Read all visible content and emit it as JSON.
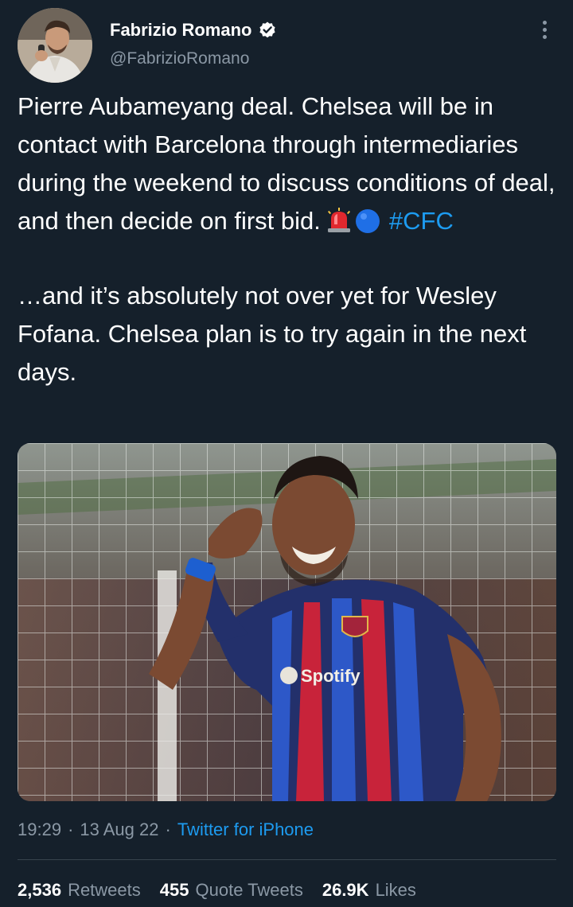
{
  "author": {
    "display_name": "Fabrizio Romano",
    "handle": "@FabrizioRomano",
    "verified_icon": "verified-badge-icon"
  },
  "tweet": {
    "paragraph1": "Pierre Aubameyang deal. Chelsea will be in contact with Barcelona through intermediaries during the weekend to discuss conditions of deal, and then decide on first bid.",
    "hashtag": "#CFC",
    "paragraph2": "…and it’s absolutely not over yet for Wesley Fofana. Chelsea plan is to try again in the next days.",
    "emojis": [
      "siren-icon",
      "blue-circle-icon"
    ]
  },
  "media": {
    "shirt_sponsor": "Spotify"
  },
  "meta": {
    "time": "19:29",
    "separator": "·",
    "date": "13 Aug 22",
    "source": "Twitter for iPhone"
  },
  "stats": {
    "retweets": {
      "count": "2,536",
      "label": "Retweets"
    },
    "quotes": {
      "count": "455",
      "label": "Quote Tweets"
    },
    "likes": {
      "count": "26.9K",
      "label": "Likes"
    }
  },
  "colors": {
    "background": "#15202b",
    "link": "#1d9bf0",
    "secondary_text": "#8b98a5"
  }
}
